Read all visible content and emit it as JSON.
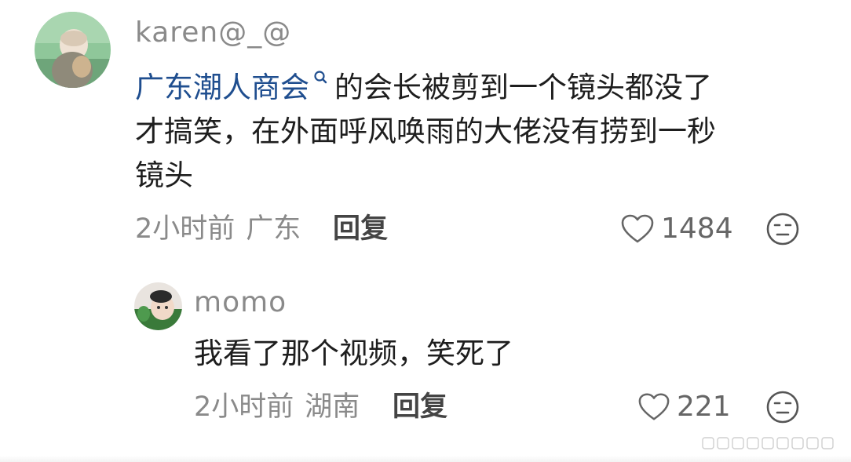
{
  "comments": [
    {
      "username": "karen@_@",
      "text_link": "广东潮人商会",
      "text_line1_rest": "的会长被剪到一个镜头都没了",
      "text_line2": "才搞笑，在外面呼风唤雨的大佬没有捞到一秒",
      "text_line3": "镜头",
      "time": "2小时前",
      "location": "广东",
      "reply_label": "回复",
      "likes": "1484",
      "avatar_icon": "baby-avatar"
    },
    {
      "username": "momo",
      "text_line1": "我看了那个视频，笑死了",
      "time": "2小时前",
      "location": "湖南",
      "reply_label": "回复",
      "likes": "221",
      "avatar_icon": "child-avatar"
    }
  ],
  "icons": {
    "like": "heart-outline-icon",
    "dislike": "meh-face-icon",
    "search": "search-icon"
  },
  "colors": {
    "link": "#1f4e8f",
    "muted": "#8a8a8a",
    "text": "#1e1e1e"
  }
}
